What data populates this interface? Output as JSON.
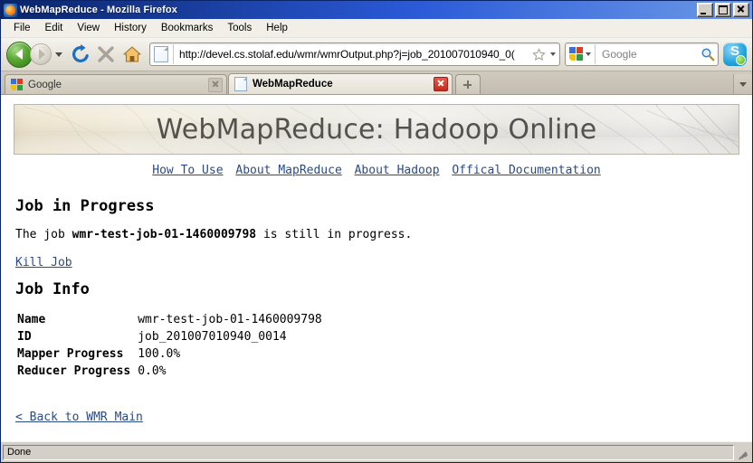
{
  "window": {
    "title": "WebMapReduce - Mozilla Firefox",
    "minimize_label": "Minimize",
    "maximize_label": "Maximize",
    "close_label": "Close"
  },
  "menu": {
    "items": [
      {
        "label": "File"
      },
      {
        "label": "Edit"
      },
      {
        "label": "View"
      },
      {
        "label": "History"
      },
      {
        "label": "Bookmarks"
      },
      {
        "label": "Tools"
      },
      {
        "label": "Help"
      }
    ]
  },
  "toolbar": {
    "back_label": "Back",
    "forward_label": "Forward",
    "history_dropdown_label": "Recent pages",
    "reload_label": "Reload",
    "stop_label": "Stop",
    "home_label": "Home",
    "url": "http://devel.cs.stolaf.edu/wmr/wmrOutput.php?j=job_201007010940_0(",
    "bookmark_label": "Bookmark this page",
    "url_dropdown_label": "Show history",
    "search_engine": "Google",
    "search_placeholder": "Google",
    "search_label": "Search",
    "skype_label": "Skype"
  },
  "tabs": {
    "items": [
      {
        "label": "Google",
        "favicon": "google-favicon",
        "active": false
      },
      {
        "label": "WebMapReduce",
        "favicon": "page-favicon",
        "active": true
      }
    ],
    "new_tab_label": "Open a new tab",
    "tab_list_label": "List all tabs"
  },
  "page": {
    "banner_title": "WebMapReduce: Hadoop Online",
    "nav_links": [
      {
        "label": "How To Use"
      },
      {
        "label": "About MapReduce"
      },
      {
        "label": "About Hadoop"
      },
      {
        "label": "Offical Documentation"
      }
    ],
    "heading": "Job in Progress",
    "status_prefix": "The job ",
    "status_job_name": "wmr-test-job-01-1460009798",
    "status_suffix": " is still in progress.",
    "kill_job_link": "Kill Job",
    "job_info_heading": "Job Info",
    "job_info": [
      {
        "label": "Name",
        "value": "wmr-test-job-01-1460009798"
      },
      {
        "label": "ID",
        "value": "job_201007010940_0014"
      },
      {
        "label": "Mapper Progress",
        "value": "100.0%"
      },
      {
        "label": "Reducer Progress",
        "value": "0.0%"
      }
    ],
    "back_link": "< Back to WMR Main"
  },
  "statusbar": {
    "text": "Done"
  },
  "colors": {
    "link": "#2a4a85",
    "titlebar_start": "#0a246a",
    "chrome": "#d4d0c8",
    "banner_text": "#55514c"
  }
}
